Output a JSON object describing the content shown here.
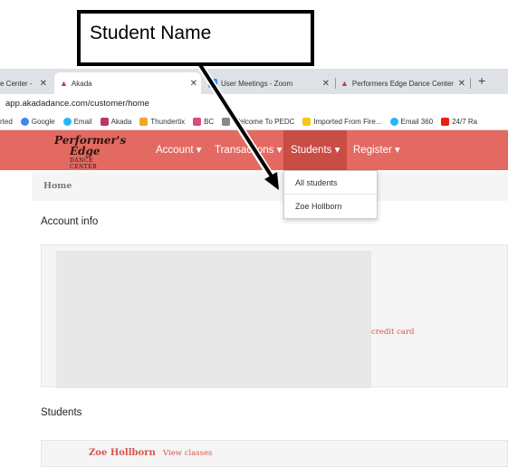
{
  "annotation": {
    "callout_text": "Student Name"
  },
  "browser": {
    "tabs": [
      {
        "title": "e Center - ",
        "close": "✕"
      },
      {
        "title": "Akada",
        "close": "✕"
      },
      {
        "title": "User Meetings - Zoom",
        "close": "✕"
      },
      {
        "title": "Performers Edge Dance Center | ",
        "close": "✕"
      }
    ],
    "new_tab": "+",
    "url": "app.akadadance.com/customer/home",
    "bookmarks": [
      {
        "label": "rted",
        "color": ""
      },
      {
        "label": "Google",
        "color": "#4285f4"
      },
      {
        "label": "Email",
        "color": "#29b6f6"
      },
      {
        "label": "Akada",
        "color": "#c0336a"
      },
      {
        "label": "Thundertix",
        "color": "#f2a623"
      },
      {
        "label": "BC",
        "color": "#d94b78"
      },
      {
        "label": "Welcome To PEDC",
        "color": "#888888"
      },
      {
        "label": "Imported From Fire...",
        "color": "#f5c518"
      },
      {
        "label": "Email 360",
        "color": "#29b6f6"
      },
      {
        "label": "24/7 Ra",
        "color": "#e62117"
      }
    ]
  },
  "site": {
    "logo": {
      "line1": "Performer's",
      "line2": "Edge",
      "line3": "DANCE CENTER"
    },
    "nav": {
      "account": "Account ▾",
      "transactions": "Transactions ▾",
      "students": "Students ▾",
      "register": "Register ▾"
    },
    "dropdown": {
      "all_students": "All students",
      "student": "Zoe Hollborn"
    },
    "breadcrumb": "Home",
    "account_info_title": "Account info",
    "credit_card_link": "credit card",
    "students_title": "Students",
    "student_row": {
      "name": "Zoe Hollborn",
      "action": "View classes"
    }
  },
  "colors": {
    "nav_bg": "#e36a62",
    "nav_active": "#c94c45",
    "link": "#d9534f"
  }
}
